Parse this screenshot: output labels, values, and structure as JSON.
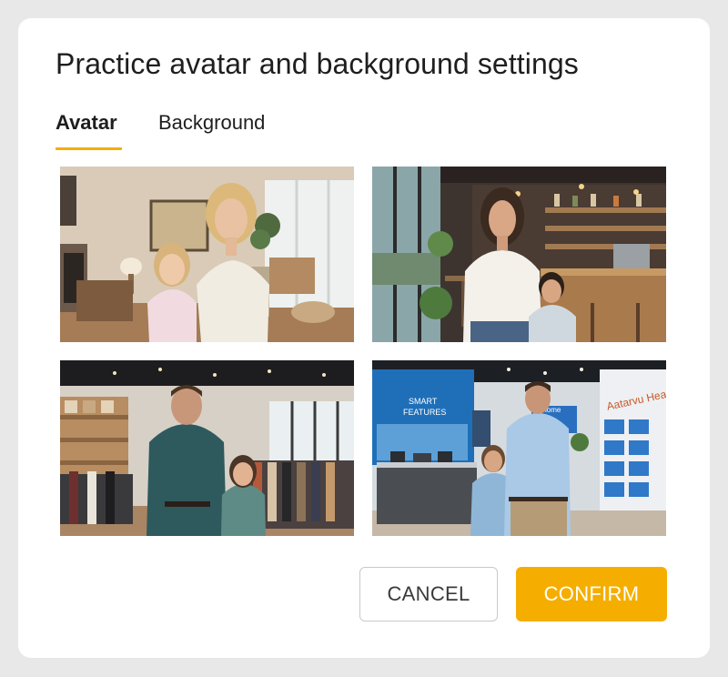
{
  "dialog": {
    "title": "Practice avatar and background settings"
  },
  "tabs": [
    {
      "label": "Avatar",
      "active": true
    },
    {
      "label": "Background",
      "active": false
    }
  ],
  "scenes": [
    {
      "icon": "living-room-scene"
    },
    {
      "icon": "cafe-scene"
    },
    {
      "icon": "clothing-store-scene"
    },
    {
      "icon": "electronics-store-scene",
      "signs": {
        "wall_sign_line1": "SMART",
        "wall_sign_line2": "FEATURES",
        "screen_text": "arthome",
        "side_sign": "Aatarvu Hean"
      }
    }
  ],
  "buttons": {
    "cancel": "CANCEL",
    "confirm": "CONFIRM"
  },
  "colors": {
    "accent": "#f5ae00",
    "tab_underline": "#f2ae00"
  }
}
